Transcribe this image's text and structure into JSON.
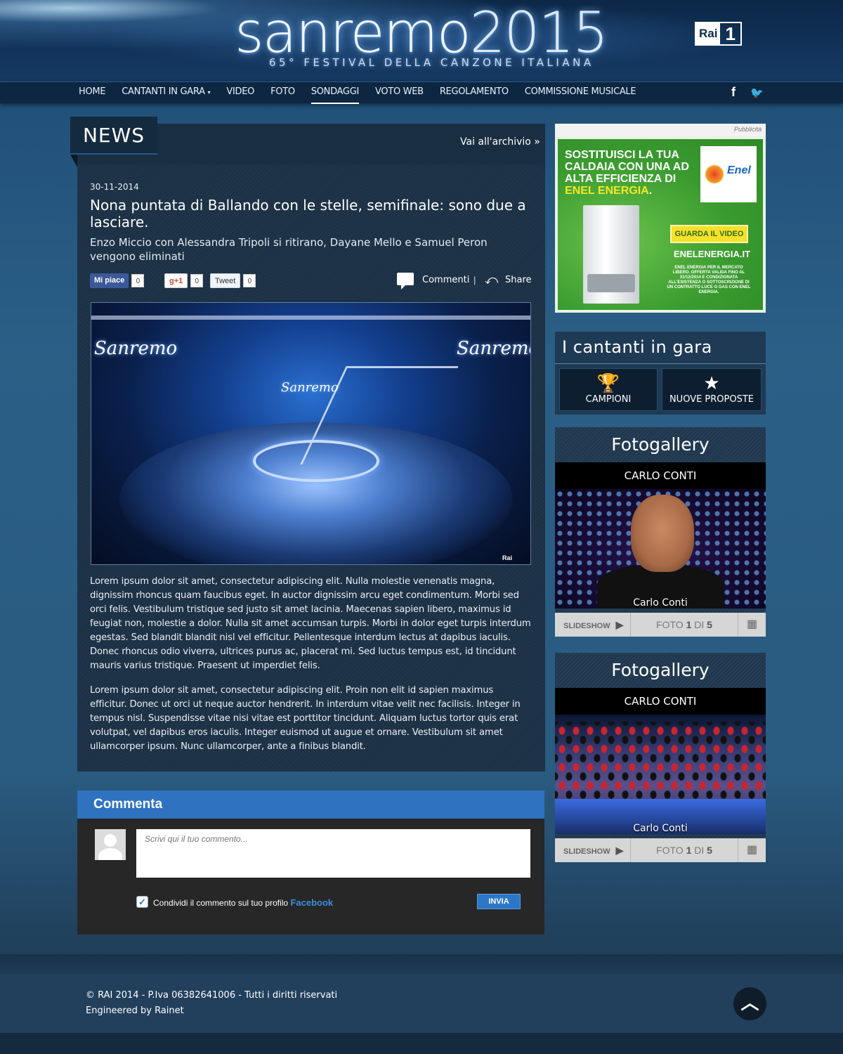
{
  "header": {
    "logo_word": "sanremo",
    "logo_year": "2015",
    "logo_subtitle": "65° FESTIVAL DELLA CANZONE ITALIANA",
    "rai_badge_text": "Rai",
    "rai_badge_number": "1"
  },
  "nav": {
    "items": [
      {
        "label": "HOME"
      },
      {
        "label": "CANTANTI IN GARA",
        "caret": "▾"
      },
      {
        "label": "VIDEO"
      },
      {
        "label": "FOTO"
      },
      {
        "label": "SONDAGGI",
        "active": true
      },
      {
        "label": "VOTO WEB"
      },
      {
        "label": "REGOLAMENTO"
      },
      {
        "label": "COMMISSIONE MUSICALE"
      }
    ],
    "social": [
      "facebook-icon",
      "twitter-icon"
    ],
    "facebook_glyph": "f",
    "twitter_glyph": "🐦"
  },
  "news": {
    "section_title": "NEWS",
    "archive_link": "Vai all'archivio »",
    "date": "30-11-2014",
    "title": "Nona puntata di Ballando con le stelle, semifinale: sono due a lasciare.",
    "subtitle": "Enzo Miccio con Alessandra Tripoli si ritirano, Dayane Mello e Samuel Peron vengono eliminati",
    "share": {
      "fb_label": "Mi piace",
      "fb_count": "0",
      "gplus_label": "g+1",
      "gplus_count": "0",
      "tweet_label": "Tweet",
      "tweet_count": "0",
      "comments_label": "Commenti",
      "separator": "|",
      "share_label": "Share"
    },
    "image_labels": {
      "left": "Sanremo",
      "right": "Sanremo",
      "center": "Sanremo",
      "watermark": "Rai"
    },
    "paragraphs": [
      "Lorem ipsum dolor sit amet, consectetur adipiscing elit. Nulla molestie venenatis magna, dignissim rhoncus quam faucibus eget. In auctor dignissim arcu eget condimentum. Morbi sed orci felis. Vestibulum tristique sed justo sit amet lacinia. Maecenas sapien libero, maximus id feugiat non, molestie a dolor. Nulla sit amet accumsan turpis. Morbi in dolor eget turpis interdum egestas. Sed blandit blandit nisl vel efficitur. Pellentesque interdum lectus at dapibus iaculis. Donec rhoncus odio viverra, ultrices purus ac, placerat mi. Sed luctus tempus est, id tincidunt mauris varius tristique. Praesent ut imperdiet felis.",
      "Lorem ipsum dolor sit amet, consectetur adipiscing elit. Proin non elit id sapien maximus efficitur. Donec ut orci ut neque auctor hendrerit. In interdum vitae velit nec facilisis. Integer in tempus nisl. Suspendisse vitae nisi vitae est porttitor tincidunt. Aliquam luctus tortor quis erat volutpat, vel dapibus eros iaculis. Integer euismod ut augue et ornare. Vestibulum sit amet ullamcorper ipsum. Nunc ullamcorper, ante a finibus blandit."
    ]
  },
  "comment": {
    "heading": "Commenta",
    "placeholder": "Scrivi qui il tuo commento...",
    "checkbox_checked": true,
    "checkbox_glyph": "✓",
    "checkbox_label": "Condividi il commento sul tuo profilo",
    "checkbox_brand": "Facebook",
    "submit_label": "INVIA"
  },
  "sidebar": {
    "ad": {
      "label": "Pubblicità",
      "headline_white": "SOSTITUISCI LA TUA CALDAIA CON UNA AD ALTA EFFICIENZA DI",
      "headline_yellow": "ENEL ENERGIA",
      "headline_end": ".",
      "brand": "Enel",
      "cta": "GUARDA IL VIDEO",
      "url": "ENELENERGIA.IT",
      "fine_print": "ENEL ENERGIA PER IL MERCATO LIBERO. OFFERTA VALIDA FINO AL 31/12/2014 E CONDIZIONATA ALL'ESISTENZA O SOTTOSCRIZIONE DI UN CONTRATTO LUCE O GAS CON ENEL ENERGIA."
    },
    "cantanti": {
      "title": "I cantanti in gara",
      "buttons": [
        {
          "label": "CAMPIONI",
          "icon": "trophy-icon",
          "glyph": "🏆"
        },
        {
          "label": "NUOVE PROPOSTE",
          "icon": "star-icon",
          "glyph": "★"
        }
      ]
    },
    "galleries": [
      {
        "title": "Fotogallery",
        "caption": "CARLO CONTI",
        "photo_caption": "Carlo Conti",
        "slideshow": "SLIDESHOW",
        "play_glyph": "▶",
        "foto_prefix": "FOTO",
        "current": "1",
        "of": "DI",
        "total": "5",
        "grid_glyph": "▦"
      },
      {
        "title": "Fotogallery",
        "caption": "CARLO CONTI",
        "photo_caption": "Carlo Conti",
        "slideshow": "SLIDESHOW",
        "play_glyph": "▶",
        "foto_prefix": "FOTO",
        "current": "1",
        "of": "DI",
        "total": "5",
        "grid_glyph": "▦"
      }
    ]
  },
  "footer": {
    "copyright": "© RAI 2014 - P.Iva 06382641006 - Tutti i diritti riservati",
    "engineered": "Engineered by Rainet",
    "to_top_glyph": "︿"
  },
  "colors": {
    "page_bg": "#27506f",
    "comment_header": "#2f72c0",
    "ad_green": "#3fa83a",
    "ad_yellow": "#f6e12a"
  }
}
